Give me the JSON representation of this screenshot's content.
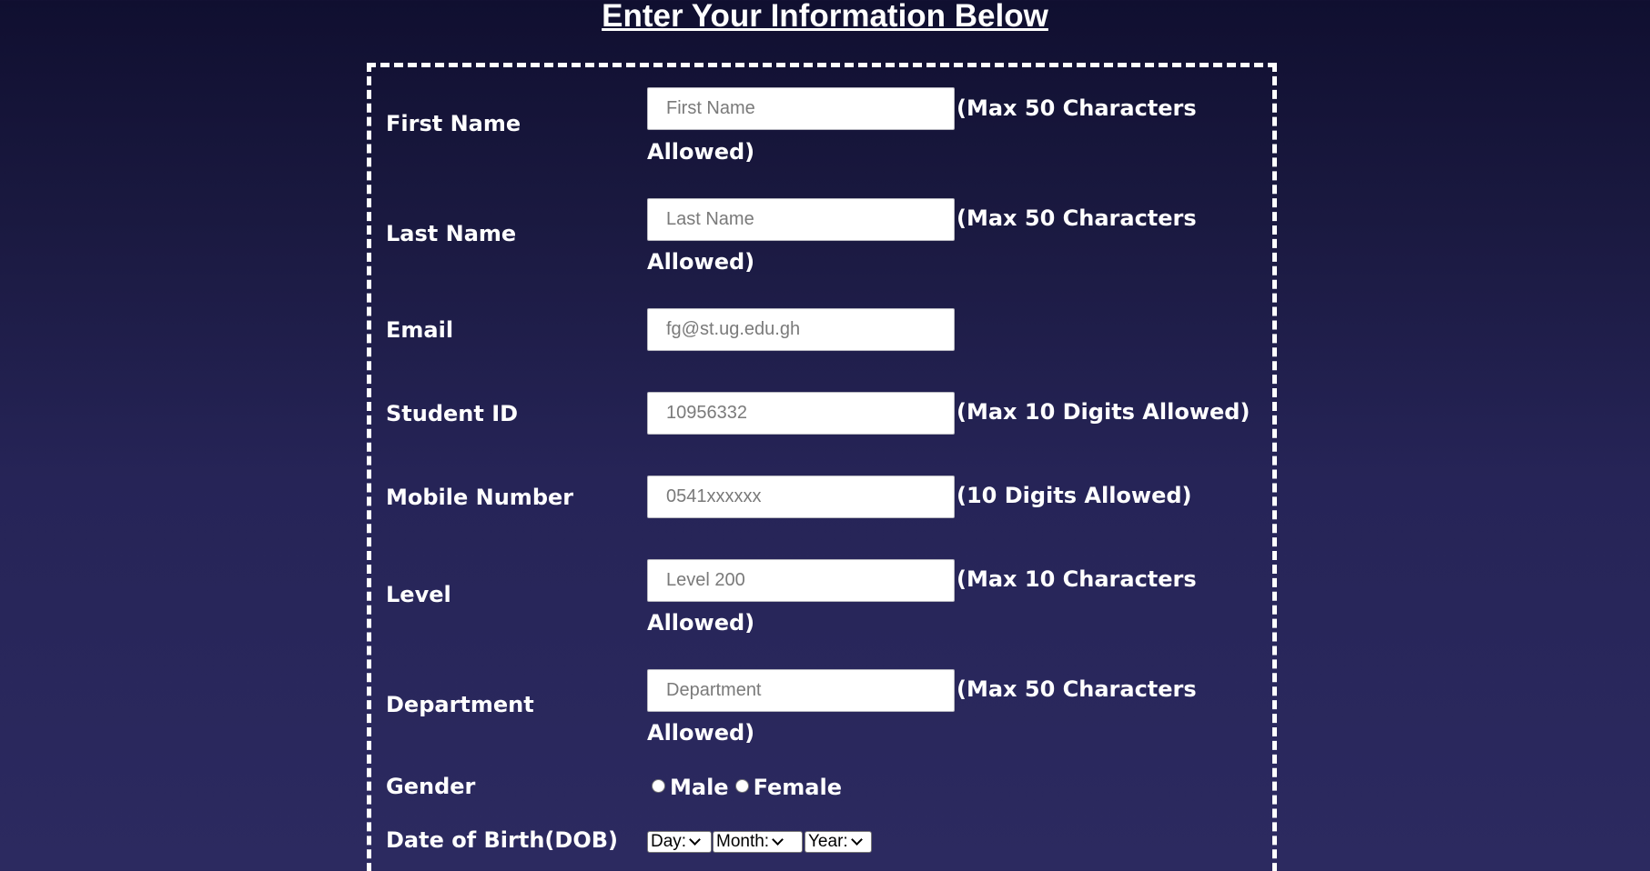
{
  "page_title": "Enter Your Information Below",
  "fields": {
    "first_name": {
      "label": "First Name",
      "placeholder": "First Name",
      "hint_line1": "(Max 50 Characters",
      "hint_line2": "Allowed)"
    },
    "last_name": {
      "label": "Last Name",
      "placeholder": "Last Name",
      "hint_line1": "(Max 50 Characters",
      "hint_line2": "Allowed)"
    },
    "email": {
      "label": "Email",
      "placeholder": "fg@st.ug.edu.gh"
    },
    "student_id": {
      "label": "Student ID",
      "placeholder": "10956332",
      "hint_line1": "(Max 10 Digits Allowed)"
    },
    "mobile": {
      "label": "Mobile Number",
      "placeholder": "0541xxxxxx",
      "hint_line1": "(10 Digits Allowed)"
    },
    "level": {
      "label": "Level",
      "placeholder": "Level 200",
      "hint_line1": "(Max 10 Characters",
      "hint_line2": "Allowed)"
    },
    "department": {
      "label": "Department",
      "placeholder": "Department",
      "hint_line1": "(Max 50 Characters",
      "hint_line2": "Allowed)"
    }
  },
  "gender": {
    "label": "Gender",
    "options": [
      "Male",
      "Female"
    ]
  },
  "dob": {
    "label": "Date of Birth(DOB)",
    "day": "Day:",
    "month": "Month:",
    "year": "Year:"
  },
  "colors": {
    "background_top": "#100f30",
    "background_bottom": "#2c2a60",
    "text": "#ffffff",
    "border": "#ffffff"
  }
}
